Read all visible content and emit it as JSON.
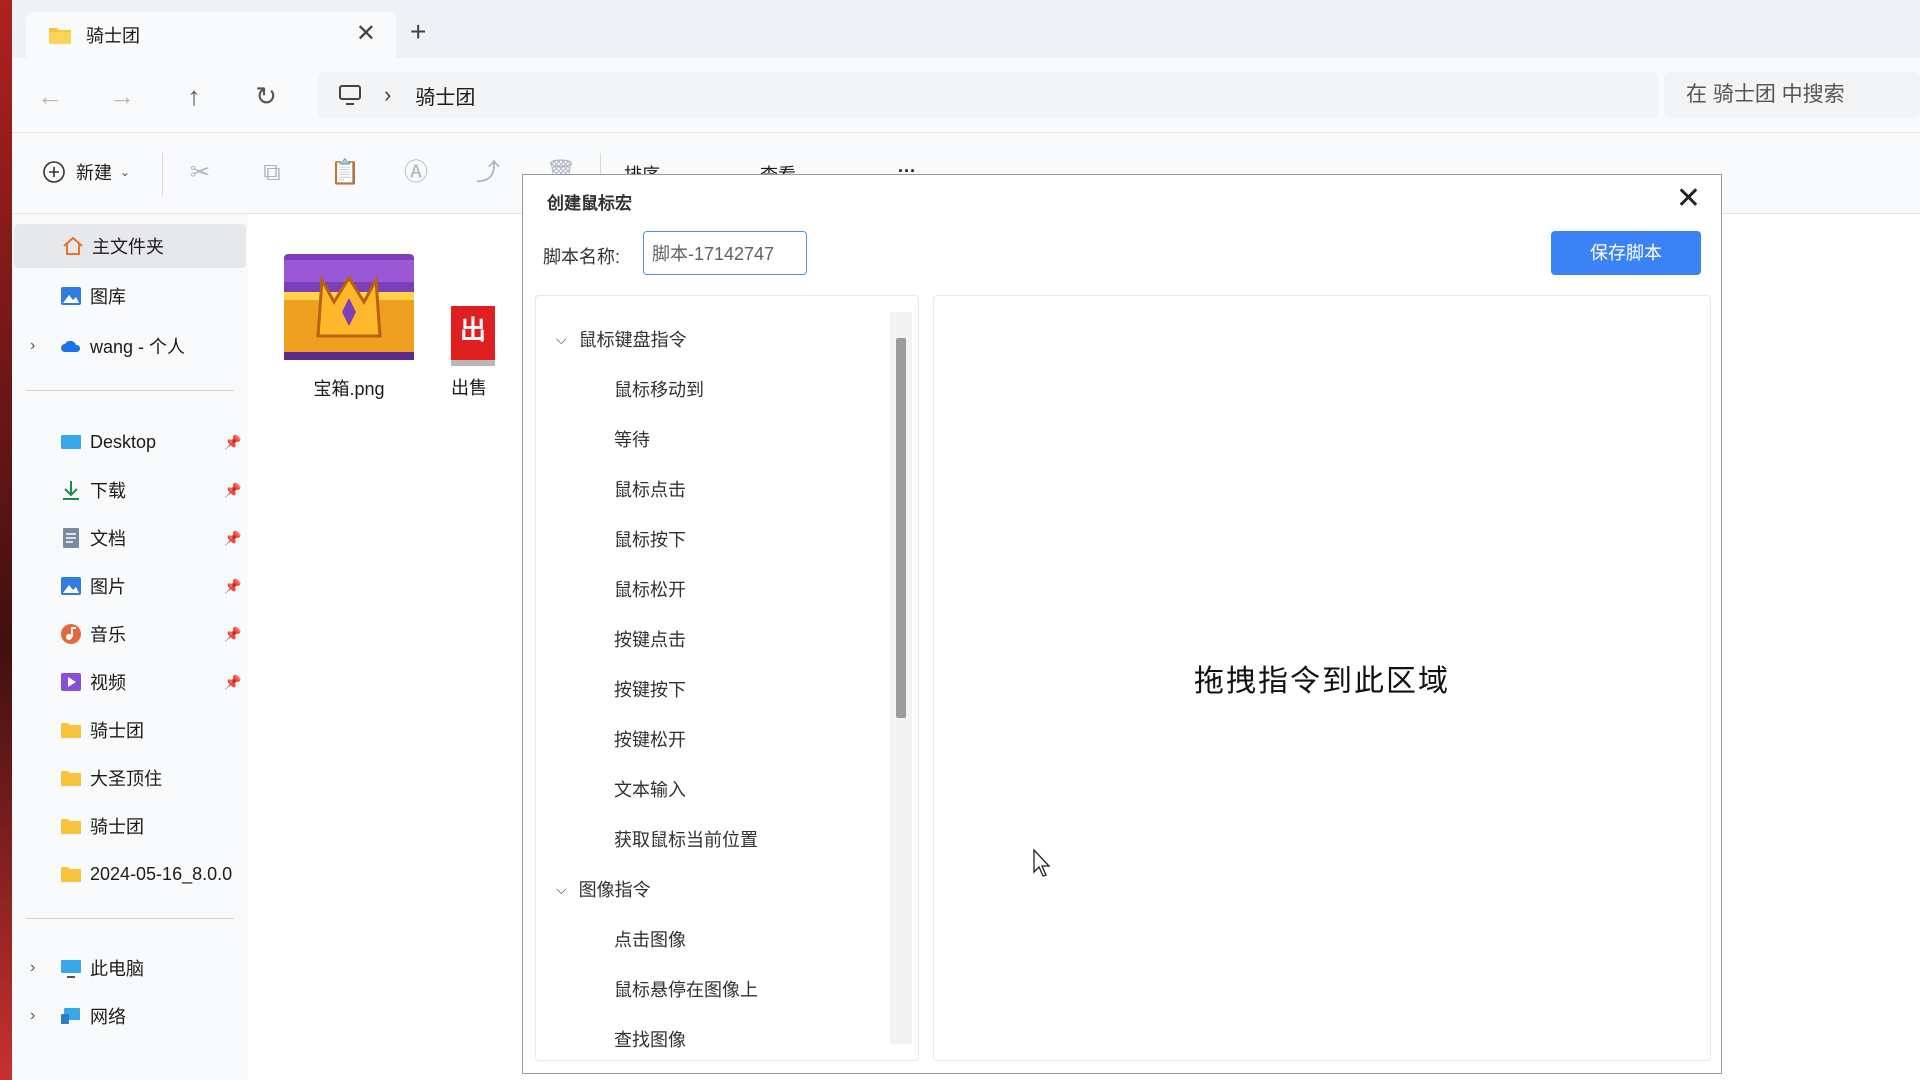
{
  "tab": {
    "title": "骑士团",
    "close": "✕",
    "add": "+"
  },
  "nav": {
    "back": "←",
    "forward": "→",
    "up": "↑",
    "refresh": "↻",
    "sep": "›",
    "breadcrumb": "骑士团",
    "search_placeholder": "在 骑士团 中搜索"
  },
  "toolbar": {
    "new_label": "新建",
    "new_chevron": "⌄",
    "sort_label": "排序",
    "view_label": "查看",
    "more": "···"
  },
  "sidebar": {
    "home": "主文件夹",
    "gallery": "图库",
    "onedrive": "wang - 个人",
    "quick": [
      {
        "label": "Desktop"
      },
      {
        "label": "下载"
      },
      {
        "label": "文档"
      },
      {
        "label": "图片"
      },
      {
        "label": "音乐"
      },
      {
        "label": "视频"
      },
      {
        "label": "骑士团"
      },
      {
        "label": "大圣顶住"
      },
      {
        "label": "骑士团"
      },
      {
        "label": "2024-05-16_8.0.0"
      }
    ],
    "thispc": "此电脑",
    "network": "网络"
  },
  "files": [
    {
      "name": "宝箱.png"
    },
    {
      "name": "出售",
      "badge": "出"
    }
  ],
  "dialog": {
    "title": "创建鼠标宏",
    "close": "✕",
    "name_label": "脚本名称:",
    "name_value": "脚本-17142747",
    "save_button": "保存脚本",
    "groups": [
      {
        "label": "鼠标键盘指令",
        "items": [
          "鼠标移动到",
          "等待",
          "鼠标点击",
          "鼠标按下",
          "鼠标松开",
          "按键点击",
          "按键按下",
          "按键松开",
          "文本输入",
          "获取鼠标当前位置"
        ]
      },
      {
        "label": "图像指令",
        "items": [
          "点击图像",
          "鼠标悬停在图像上",
          "查找图像"
        ]
      }
    ],
    "drop_hint": "拖拽指令到此区域"
  },
  "colors": {
    "accent": "#3b82f6",
    "folder": "#f8c43a"
  }
}
